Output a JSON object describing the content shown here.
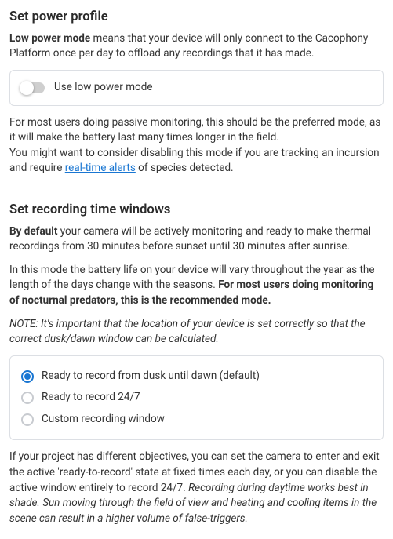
{
  "power": {
    "heading": "Set power profile",
    "desc_bold": "Low power mode",
    "desc_rest": " means that your device will only connect to the Cacophony Platform once per day to offload any recordings that it has made.",
    "toggle_label": "Use low power mode",
    "after_p1": "For most users doing passive monitoring, this should be the preferred mode, as it will make the battery last many times longer in the field.",
    "after_p2_a": "You might want to consider disabling this mode if you are tracking an incursion and require ",
    "after_link": "real-time alerts",
    "after_p2_b": " of species detected."
  },
  "recording": {
    "heading": "Set recording time windows",
    "p1_bold": "By default",
    "p1_rest": " your camera will be actively monitoring and ready to make thermal recordings from 30 minutes before sunset until 30 minutes after sunrise.",
    "p2_a": "In this mode the battery life on your device will vary throughout the year as the length of the days change with the seasons. ",
    "p2_bold": "For most users doing monitoring of nocturnal predators, this is the recommended mode.",
    "note": "NOTE: It's important that the location of your device is set correctly so that the correct dusk/dawn window can be calculated.",
    "options": {
      "opt1": "Ready to record from dusk until dawn (default)",
      "opt2": "Ready to record 24/7",
      "opt3": "Custom recording window"
    },
    "after_a": "If your project has different objectives, you can set the camera to enter and exit the active 'ready-to-record' state at fixed times each day, or you can disable the active window entirely to record 24/7. ",
    "after_em": "Recording during daytime works best in shade. Sun moving through the field of view and heating and cooling items in the scene can result in a higher volume of false-triggers."
  }
}
